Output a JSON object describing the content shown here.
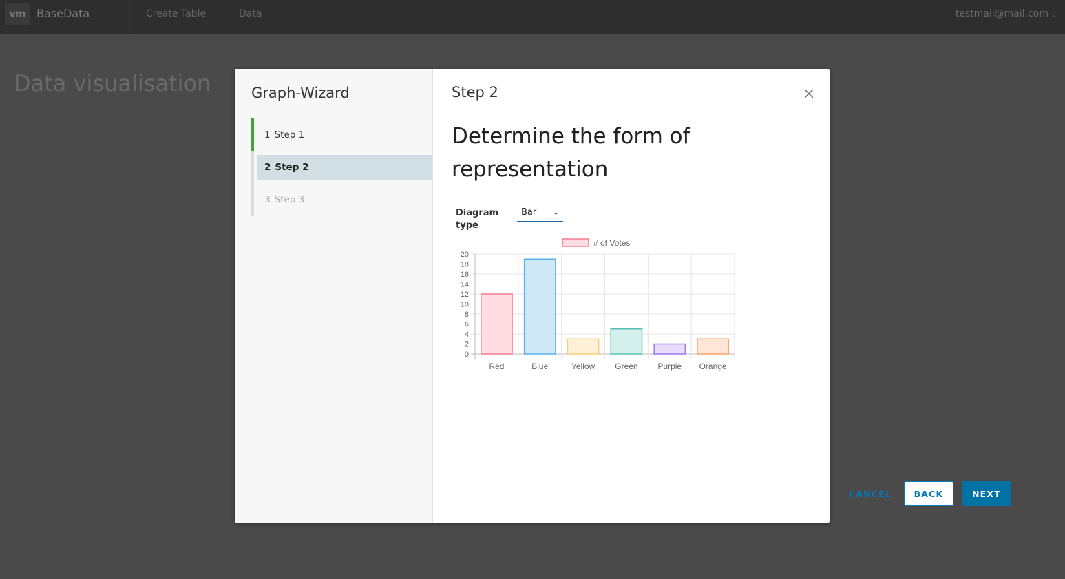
{
  "header": {
    "logo": "vm",
    "app_name": "BaseData",
    "nav": [
      "Create Table",
      "Data"
    ],
    "user": "testmail@mail.com"
  },
  "page": {
    "title": "Data visualisation"
  },
  "wizard": {
    "title": "Graph-Wizard",
    "steps": [
      {
        "num": "1",
        "label": "Step 1",
        "state": "completed"
      },
      {
        "num": "2",
        "label": "Step 2",
        "state": "current"
      },
      {
        "num": "3",
        "label": "Step 3",
        "state": "disabled"
      }
    ],
    "step_heading": "Step 2",
    "main_heading": "Determine the form of representation",
    "diagram_type_label": "Diagram type",
    "diagram_type_value": "Bar",
    "buttons": {
      "cancel": "CANCEL",
      "back": "BACK",
      "next": "NEXT"
    },
    "colors": {
      "active_step": "#3fa535",
      "primary": "#0072a3"
    }
  },
  "chart_data": {
    "type": "bar",
    "categories": [
      "Red",
      "Blue",
      "Yellow",
      "Green",
      "Purple",
      "Orange"
    ],
    "series": [
      {
        "name": "# of Votes",
        "values": [
          12,
          19,
          3,
          5,
          2,
          3
        ]
      }
    ],
    "ylim": [
      0,
      20
    ],
    "yticks": [
      "0",
      "2",
      "4",
      "6",
      "8",
      "10",
      "12",
      "14",
      "16",
      "18",
      "20"
    ],
    "legend": "top",
    "grid": true,
    "fill_colors": [
      "#ffdde3",
      "#cfe8f7",
      "#fff1d8",
      "#d4f0ed",
      "#e6dcfb",
      "#ffe6d6"
    ],
    "stroke_colors": [
      "#f27c93",
      "#5bb0e6",
      "#f8cd7c",
      "#58c1b5",
      "#9c78f2",
      "#f9a36a"
    ]
  }
}
